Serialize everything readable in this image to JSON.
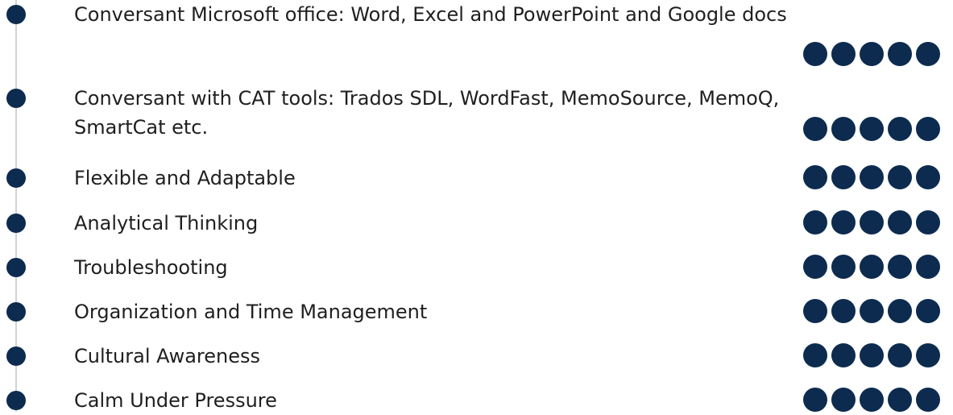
{
  "colors": {
    "accent": "#0d2b4f",
    "timeline": "#cfd3d8",
    "text": "#1f1f1f"
  },
  "icons": {
    "bullet": "filled-circle",
    "rating": "filled-circle"
  },
  "skills": [
    {
      "lines": [
        "Conversant Microsoft office: Word, Excel and PowerPoint and Google docs"
      ],
      "rating": 5,
      "max": 5
    },
    {
      "lines": [
        "Conversant with CAT tools: Trados SDL, WordFast, MemoSource, MemoQ,",
        "SmartCat etc."
      ],
      "rating": 5,
      "max": 5
    },
    {
      "lines": [
        "Flexible and Adaptable"
      ],
      "rating": 5,
      "max": 5
    },
    {
      "lines": [
        "Analytical Thinking"
      ],
      "rating": 5,
      "max": 5
    },
    {
      "lines": [
        "Troubleshooting"
      ],
      "rating": 5,
      "max": 5
    },
    {
      "lines": [
        "Organization and Time Management"
      ],
      "rating": 5,
      "max": 5
    },
    {
      "lines": [
        "Cultural Awareness"
      ],
      "rating": 5,
      "max": 5
    },
    {
      "lines": [
        "Calm Under Pressure"
      ],
      "rating": 5,
      "max": 5
    }
  ]
}
